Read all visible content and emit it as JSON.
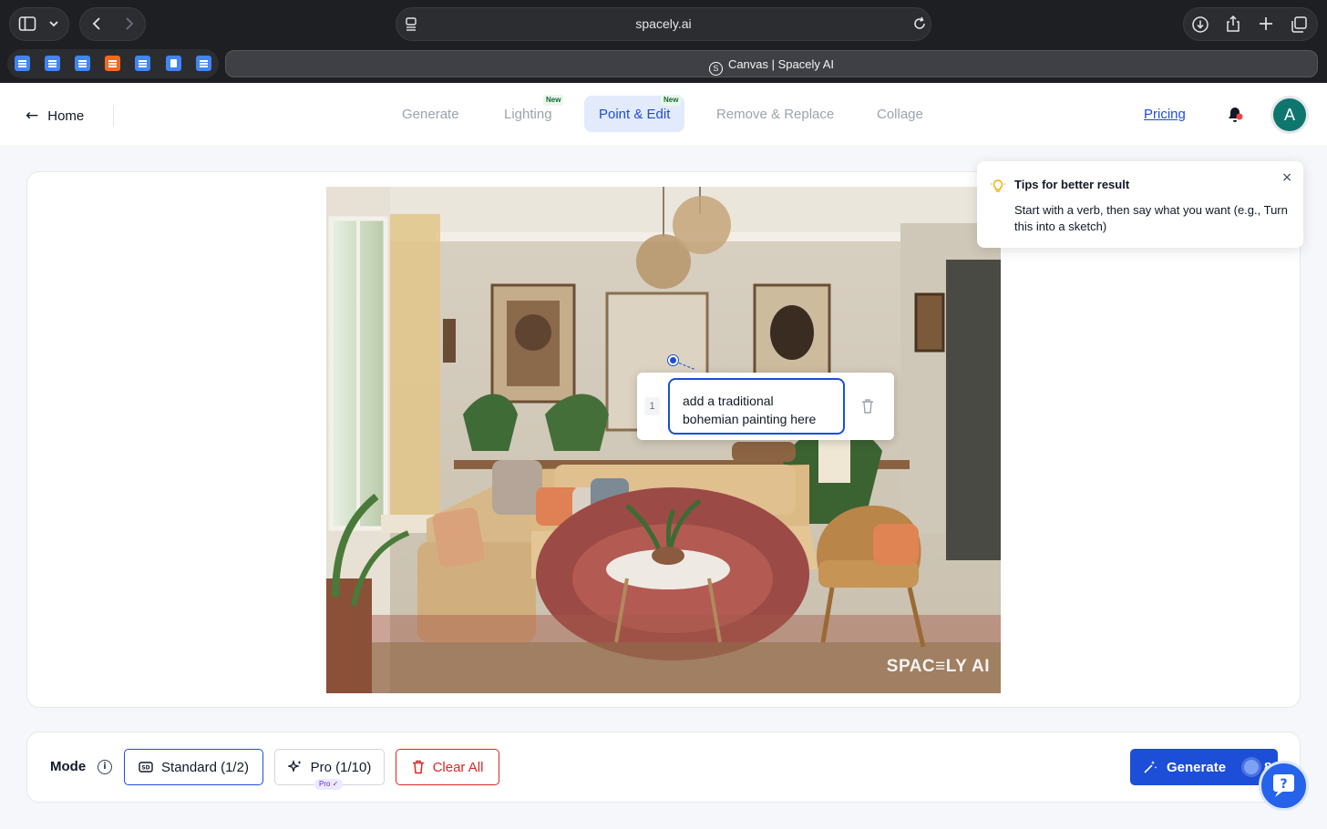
{
  "browser": {
    "url": "spacely.ai",
    "active_tab_title": "Canvas | Spacely AI"
  },
  "header": {
    "home_label": "Home",
    "tabs": [
      {
        "label": "Generate",
        "badge": ""
      },
      {
        "label": "Lighting",
        "badge": "New"
      },
      {
        "label": "Point & Edit",
        "badge": "New"
      },
      {
        "label": "Remove & Replace",
        "badge": ""
      },
      {
        "label": "Collage",
        "badge": ""
      }
    ],
    "pricing_label": "Pricing",
    "avatar_initial": "A"
  },
  "canvas": {
    "watermark": "SPAC≡LY AI",
    "edit_point": {
      "number": "1",
      "prompt_text": "add a traditional bohemian painting here"
    }
  },
  "tips": {
    "title": "Tips for better result",
    "body": "Start with a verb, then say what you want (e.g., Turn this into a sketch)"
  },
  "bottom": {
    "mode_label": "Mode",
    "standard_label": "Standard (1/2)",
    "pro_label": "Pro (1/10)",
    "pro_chip": "Pro ✓",
    "clear_label": "Clear All",
    "generate_label": "Generate",
    "credits": "8"
  },
  "colors": {
    "accent": "#1d4ed8",
    "danger": "#dc2626",
    "avatar": "#0f766e"
  }
}
